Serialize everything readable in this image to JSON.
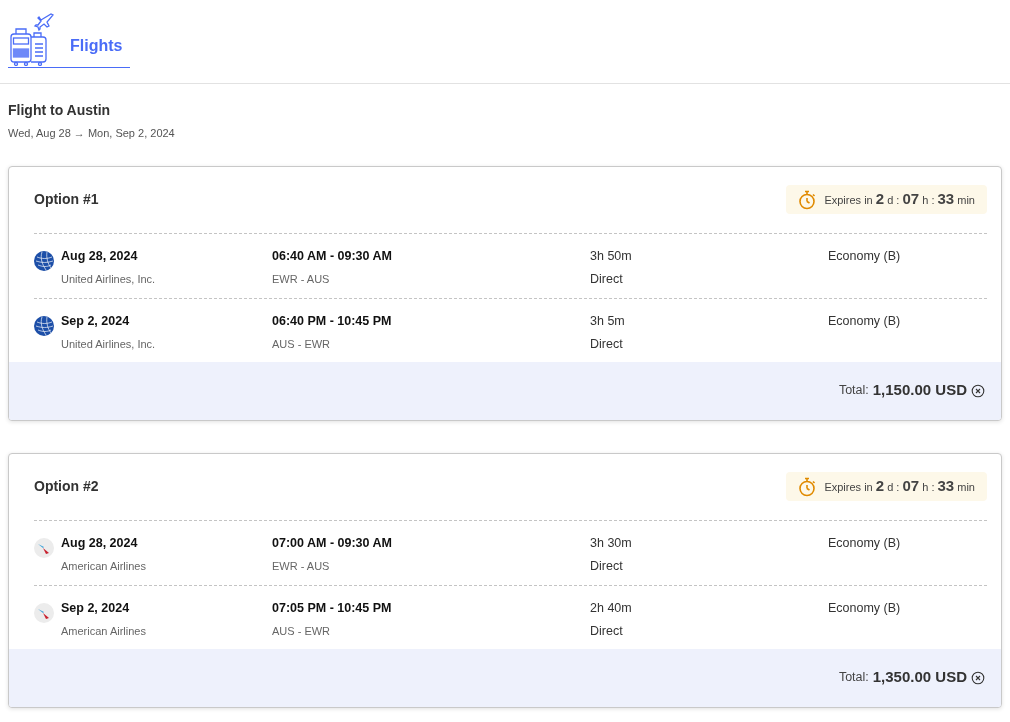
{
  "header": {
    "title": "Flights"
  },
  "trip": {
    "title": "Flight to Austin",
    "dates": "Wed, Aug 28 → Mon, Sep 2, 2024"
  },
  "options": [
    {
      "title": "Option #1",
      "expiry": [
        {
          "text": "Expires in",
          "big": false
        },
        {
          "text": "2",
          "big": true
        },
        {
          "text": "d :",
          "big": false
        },
        {
          "text": "07",
          "big": true
        },
        {
          "text": "h :",
          "big": false
        },
        {
          "text": "33",
          "big": true
        },
        {
          "text": "min",
          "big": false
        }
      ],
      "legs": [
        {
          "kind": "united",
          "date": "Aug 28, 2024",
          "airline": "United Airlines, Inc.",
          "time": "06:40 AM - 09:30 AM",
          "route": "EWR - AUS",
          "duration": "3h 50m",
          "stops": "Direct",
          "cabin": "Economy (B)"
        },
        {
          "kind": "united",
          "date": "Sep 2, 2024",
          "airline": "United Airlines, Inc.",
          "time": "06:40 PM - 10:45 PM",
          "route": "AUS - EWR",
          "duration": "3h 5m",
          "stops": "Direct",
          "cabin": "Economy (B)"
        }
      ],
      "total_label": "Total:",
      "total": "1,150.00 USD"
    },
    {
      "title": "Option #2",
      "expiry": [
        {
          "text": "Expires in",
          "big": false
        },
        {
          "text": "2",
          "big": true
        },
        {
          "text": "d :",
          "big": false
        },
        {
          "text": "07",
          "big": true
        },
        {
          "text": "h :",
          "big": false
        },
        {
          "text": "33",
          "big": true
        },
        {
          "text": "min",
          "big": false
        }
      ],
      "legs": [
        {
          "kind": "american",
          "date": "Aug 28, 2024",
          "airline": "American Airlines",
          "time": "07:00 AM - 09:30 AM",
          "route": "EWR - AUS",
          "duration": "3h 30m",
          "stops": "Direct",
          "cabin": "Economy (B)"
        },
        {
          "kind": "american",
          "date": "Sep 2, 2024",
          "airline": "American Airlines",
          "time": "07:05 PM - 10:45 PM",
          "route": "AUS - EWR",
          "duration": "2h 40m",
          "stops": "Direct",
          "cabin": "Economy (B)"
        }
      ],
      "total_label": "Total:",
      "total": "1,350.00 USD"
    }
  ]
}
